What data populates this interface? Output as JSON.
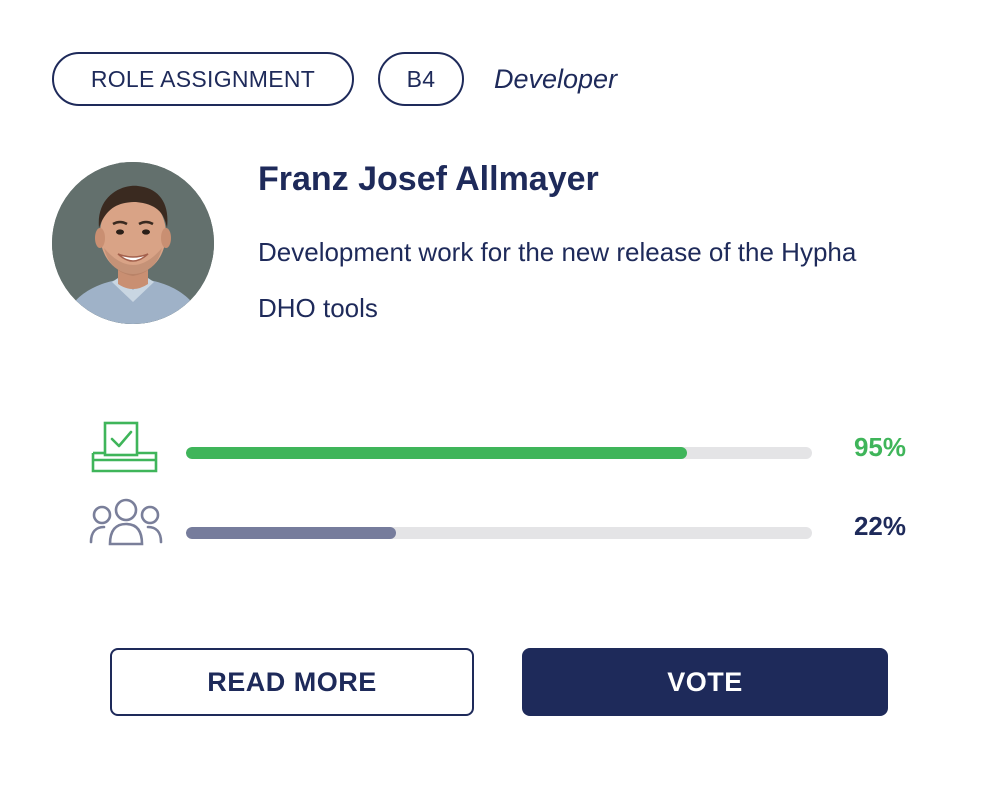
{
  "header": {
    "type_label": "ROLE ASSIGNMENT",
    "band_label": "B4",
    "role_title": "Developer"
  },
  "profile": {
    "name": "Franz Josef Allmayer",
    "description": "Development work for the new release of the Hypha DHO tools",
    "avatar_icon": "person-photo"
  },
  "metrics": {
    "approval": {
      "icon": "ballot-check-icon",
      "percent_label": "95%",
      "fill_fraction": 0.8,
      "color": "#3fb55a"
    },
    "quorum": {
      "icon": "group-icon",
      "percent_label": "22%",
      "fill_fraction": 0.335,
      "color": "#767c9c"
    }
  },
  "actions": {
    "read_more_label": "READ MORE",
    "vote_label": "VOTE"
  },
  "colors": {
    "primary": "#1e2a5a",
    "success": "#3fb55a",
    "track": "#e4e4e6"
  }
}
